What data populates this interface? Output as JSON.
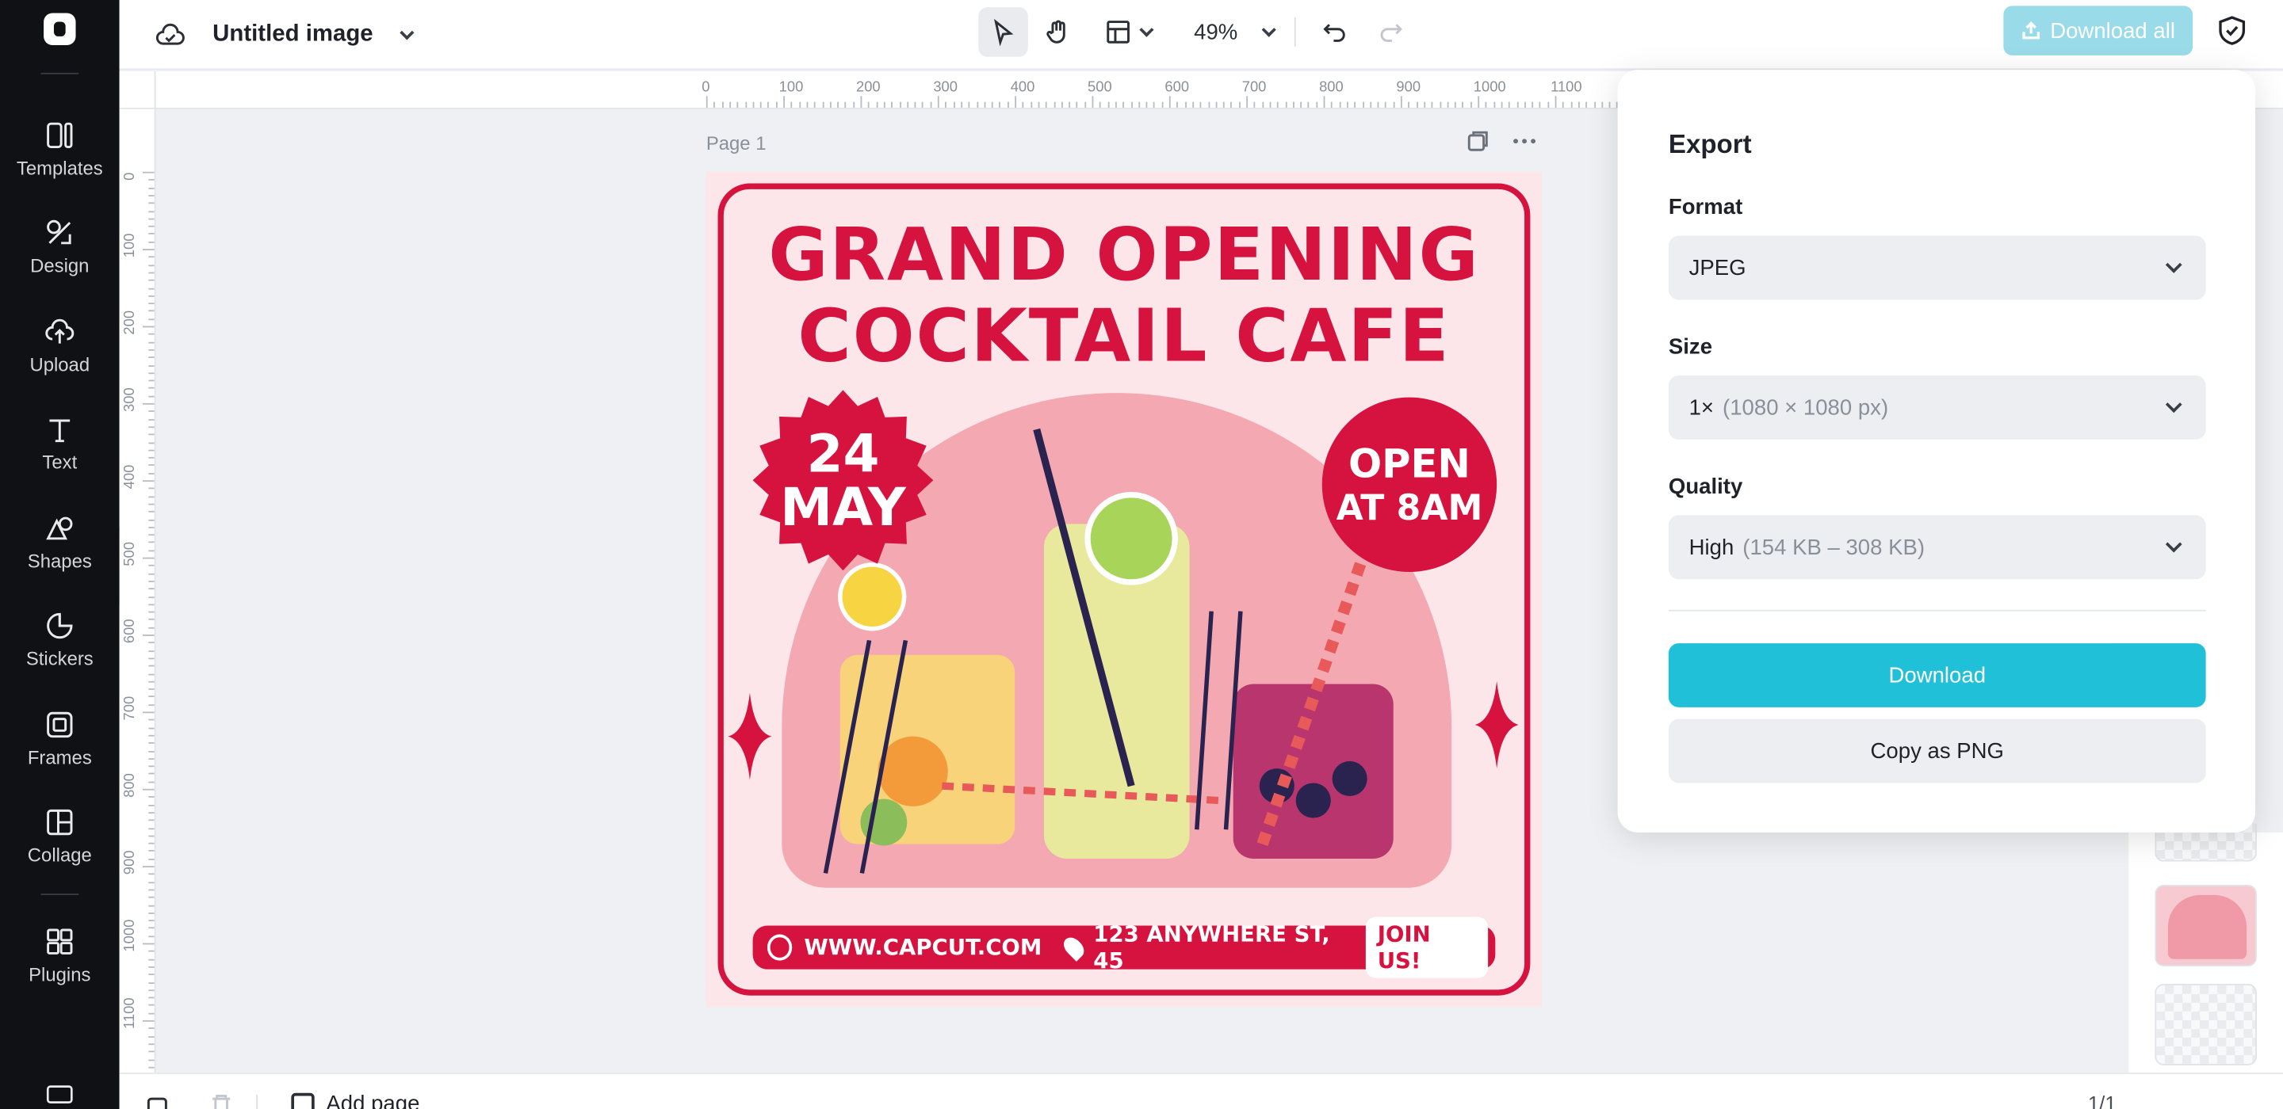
{
  "sidebar": {
    "items": [
      {
        "label": "Templates",
        "icon": "templates-icon"
      },
      {
        "label": "Design",
        "icon": "design-icon"
      },
      {
        "label": "Upload",
        "icon": "upload-icon"
      },
      {
        "label": "Text",
        "icon": "text-icon"
      },
      {
        "label": "Shapes",
        "icon": "shapes-icon"
      },
      {
        "label": "Stickers",
        "icon": "stickers-icon"
      },
      {
        "label": "Frames",
        "icon": "frames-icon"
      },
      {
        "label": "Collage",
        "icon": "collage-icon"
      },
      {
        "label": "Plugins",
        "icon": "plugins-icon"
      }
    ]
  },
  "header": {
    "doc_title": "Untitled image",
    "zoom": "49%",
    "download_all": "Download all"
  },
  "ruler": {
    "top": [
      "0",
      "100",
      "200",
      "300",
      "400",
      "500",
      "600",
      "700",
      "800",
      "900",
      "1000",
      "1100"
    ],
    "left": [
      "0",
      "100",
      "200",
      "300",
      "400",
      "500",
      "600",
      "700",
      "800",
      "900",
      "1000",
      "1100"
    ]
  },
  "canvas": {
    "page_label": "Page 1"
  },
  "poster": {
    "title_line1": "GRAND OPENING",
    "title_line2": "COCKTAIL CAFE",
    "date_line1": "24",
    "date_line2": "MAY",
    "open_line1": "OPEN",
    "open_line2": "AT 8AM",
    "website": "WWW.CAPCUT.COM",
    "address": "123 ANYWHERE ST, 45",
    "cta": "JOIN US!",
    "colors": {
      "primary": "#d6123f",
      "background": "#fde6ea",
      "arch": "#f4a8b1"
    }
  },
  "export_panel": {
    "title": "Export",
    "format_label": "Format",
    "format_value": "JPEG",
    "size_label": "Size",
    "size_value": "1×",
    "size_detail": "(1080 × 1080 px)",
    "quality_label": "Quality",
    "quality_value": "High",
    "quality_detail": "(154 KB – 308 KB)",
    "download_button": "Download",
    "copy_button": "Copy as PNG"
  },
  "bottom": {
    "add_page": "Add page",
    "page_count": "1/1"
  }
}
